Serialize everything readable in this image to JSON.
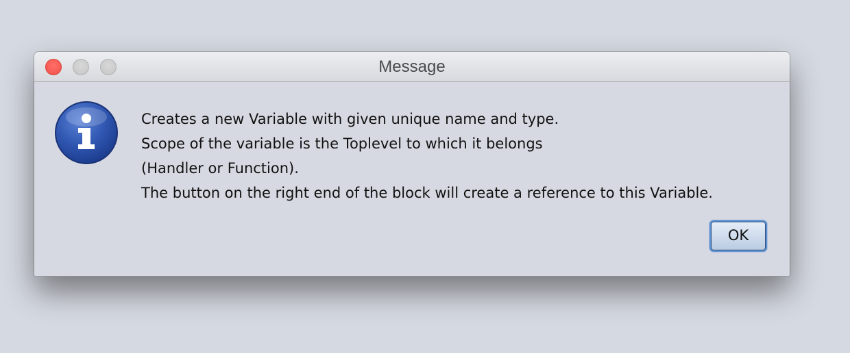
{
  "window": {
    "title": "Message"
  },
  "dialog": {
    "icon": "info-icon",
    "message_lines": [
      "Creates a new Variable with given unique name and type.",
      "Scope of the variable is the Toplevel to which it belongs",
      "(Handler or Function).",
      "The button on the right end of the block will create a reference to this Variable."
    ],
    "ok_label": "OK"
  },
  "colors": {
    "close_button": "#f05048",
    "info_icon": "#2f56b0",
    "ok_border": "#5b8fd1"
  }
}
